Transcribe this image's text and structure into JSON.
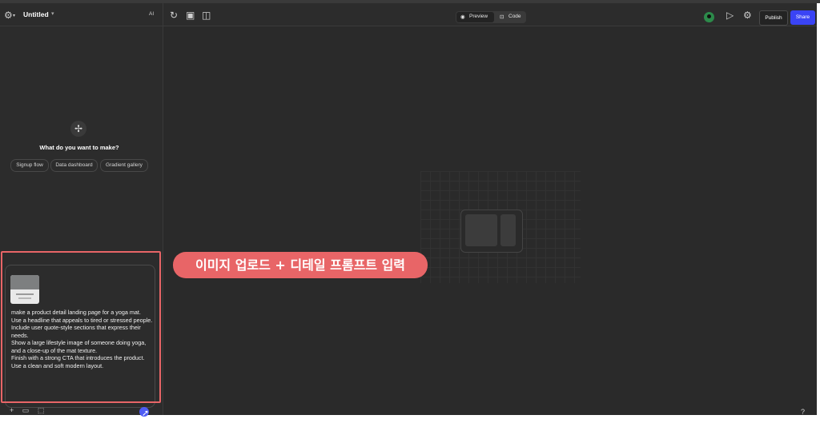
{
  "app": {
    "title": "Untitled",
    "ai_label": "AI"
  },
  "empty_state": {
    "question": "What do you want to make?",
    "suggestions": [
      "Signup flow",
      "Data dashboard",
      "Gradient gallery"
    ]
  },
  "prompt": {
    "text": "make a product detail landing page for a yoga mat.\nUse a headline that appeals to tired or stressed people.\nInclude user quote-style sections that express their needs.\nShow a large lifestyle image of someone doing yoga,\nand a close-up of the mat texture.\nFinish with a strong CTA that introduces the product.\nUse a clean and soft modern layout."
  },
  "toolbar": {
    "preview_label": "Preview",
    "code_label": "Code",
    "publish_label": "Publish",
    "share_label": "Share"
  },
  "annotation": {
    "callout_text": "이미지 업로드 + 디테일 프롬프트 입력"
  },
  "colors": {
    "accent_red": "#e86567",
    "share_blue": "#3a44f5",
    "background": "#2a2a2a"
  }
}
